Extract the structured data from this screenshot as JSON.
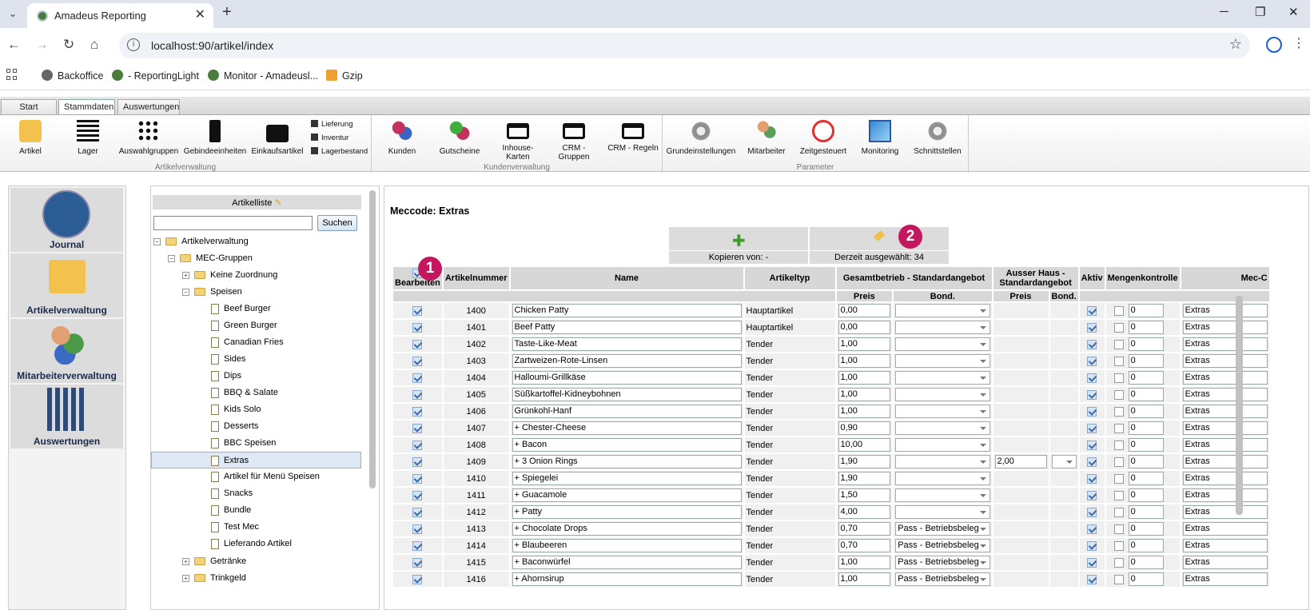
{
  "browser": {
    "tab_title": "Amadeus Reporting",
    "url": "localhost:90/artikel/index",
    "bookmarks": [
      "Backoffice",
      "- ReportingLight",
      "Monitor - Amadeusl...",
      "Gzip"
    ]
  },
  "ribbon": {
    "tabs": [
      "Start",
      "Stammdaten",
      "Auswertungen"
    ],
    "artikelverwaltung": {
      "label": "Artikelverwaltung",
      "buttons": [
        "Artikel",
        "Lager",
        "Auswahlgruppen",
        "Gebindeeinheiten",
        "Einkaufsartikel"
      ],
      "small": [
        "Lieferung",
        "Inventur",
        "Lagerbestand"
      ]
    },
    "kundenverwaltung": {
      "label": "Kundenverwaltung",
      "buttons": [
        "Kunden",
        "Gutscheine",
        "Inhouse-Karten",
        "CRM - Gruppen",
        "CRM - Regeln"
      ]
    },
    "parameter": {
      "label": "Parameter",
      "buttons": [
        "Grundeinstellungen",
        "Mitarbeiter",
        "Zeitgesteuert",
        "Monitoring",
        "Schnittstellen"
      ]
    }
  },
  "left_nav": [
    "Journal",
    "Artikelverwaltung",
    "Mitarbeiterverwaltung",
    "Auswertungen"
  ],
  "tree": {
    "header": "Artikelliste",
    "search_button": "Suchen",
    "root": "Artikelverwaltung",
    "group": "MEC-Gruppen",
    "keine_zuordnung": "Keine Zuordnung",
    "speisen": "Speisen",
    "speisen_children": [
      "Beef Burger",
      "Green Burger",
      "Canadian Fries",
      "Sides",
      "Dips",
      "BBQ & Salate",
      "Kids Solo",
      "Desserts",
      "BBC Speisen",
      "Extras",
      "Artikel für Menü Speisen",
      "Snacks",
      "Bundle",
      "Test Mec",
      "Lieferando Artikel"
    ],
    "selected": "Extras",
    "more_groups": [
      "Getränke",
      "Trinkgeld"
    ]
  },
  "content": {
    "title": "Meccode: Extras",
    "copy_label": "Kopieren von: -",
    "selected_label": "Derzeit ausgewählt: 34",
    "markers": [
      "1",
      "2"
    ],
    "headers": {
      "bearbeiten": "Bearbeiten",
      "artikelnummer": "Artikelnummer",
      "name": "Name",
      "artikeltyp": "Artikeltyp",
      "gesamtbetrieb": "Gesamtbetrieb - Standardangebot",
      "ausser_haus": "Ausser Haus - Standardangebot",
      "aktiv": "Aktiv",
      "mengenkontrolle": "Mengenkontrolle",
      "mec": "Mec-C",
      "preis": "Preis",
      "bond": "Bond."
    },
    "rows": [
      {
        "nr": "1400",
        "name": "Chicken Patty",
        "typ": "Hauptartikel",
        "preis": "0,00",
        "bond": "",
        "ah_preis": "",
        "menge": "0",
        "mec": "Extras"
      },
      {
        "nr": "1401",
        "name": "Beef Patty",
        "typ": "Hauptartikel",
        "preis": "0,00",
        "bond": "",
        "ah_preis": "",
        "menge": "0",
        "mec": "Extras"
      },
      {
        "nr": "1402",
        "name": "Taste-Like-Meat",
        "typ": "Tender",
        "preis": "1,00",
        "bond": "",
        "ah_preis": "",
        "menge": "0",
        "mec": "Extras"
      },
      {
        "nr": "1403",
        "name": "Zartweizen-Rote-Linsen",
        "typ": "Tender",
        "preis": "1,00",
        "bond": "",
        "ah_preis": "",
        "menge": "0",
        "mec": "Extras"
      },
      {
        "nr": "1404",
        "name": "Halloumi-Grillkäse",
        "typ": "Tender",
        "preis": "1,00",
        "bond": "",
        "ah_preis": "",
        "menge": "0",
        "mec": "Extras"
      },
      {
        "nr": "1405",
        "name": "Süßkartoffel-Kidneybohnen",
        "typ": "Tender",
        "preis": "1,00",
        "bond": "",
        "ah_preis": "",
        "menge": "0",
        "mec": "Extras"
      },
      {
        "nr": "1406",
        "name": "Grünkohl-Hanf",
        "typ": "Tender",
        "preis": "1,00",
        "bond": "",
        "ah_preis": "",
        "menge": "0",
        "mec": "Extras"
      },
      {
        "nr": "1407",
        "name": "+ Chester-Cheese",
        "typ": "Tender",
        "preis": "0,90",
        "bond": "",
        "ah_preis": "",
        "menge": "0",
        "mec": "Extras"
      },
      {
        "nr": "1408",
        "name": "+ Bacon",
        "typ": "Tender",
        "preis": "10,00",
        "bond": "",
        "ah_preis": "",
        "menge": "0",
        "mec": "Extras"
      },
      {
        "nr": "1409",
        "name": "+ 3 Onion Rings",
        "typ": "Tender",
        "preis": "1,90",
        "bond": "",
        "ah_preis": "2,00",
        "menge": "0",
        "mec": "Extras"
      },
      {
        "nr": "1410",
        "name": "+ Spiegelei",
        "typ": "Tender",
        "preis": "1,90",
        "bond": "",
        "ah_preis": "",
        "menge": "0",
        "mec": "Extras"
      },
      {
        "nr": "1411",
        "name": "+ Guacamole",
        "typ": "Tender",
        "preis": "1,50",
        "bond": "",
        "ah_preis": "",
        "menge": "0",
        "mec": "Extras"
      },
      {
        "nr": "1412",
        "name": "+ Patty",
        "typ": "Tender",
        "preis": "4,00",
        "bond": "",
        "ah_preis": "",
        "menge": "0",
        "mec": "Extras"
      },
      {
        "nr": "1413",
        "name": "+ Chocolate Drops",
        "typ": "Tender",
        "preis": "0,70",
        "bond": "Pass - Betriebsbeleg",
        "ah_preis": "",
        "menge": "0",
        "mec": "Extras"
      },
      {
        "nr": "1414",
        "name": "+ Blaubeeren",
        "typ": "Tender",
        "preis": "0,70",
        "bond": "Pass - Betriebsbeleg",
        "ah_preis": "",
        "menge": "0",
        "mec": "Extras"
      },
      {
        "nr": "1415",
        "name": "+ Baconwürfel",
        "typ": "Tender",
        "preis": "1,00",
        "bond": "Pass - Betriebsbeleg",
        "ah_preis": "",
        "menge": "0",
        "mec": "Extras"
      },
      {
        "nr": "1416",
        "name": "+ Ahornsirup",
        "typ": "Tender",
        "preis": "1,00",
        "bond": "Pass - Betriebsbeleg",
        "ah_preis": "",
        "menge": "0",
        "mec": "Extras"
      }
    ]
  }
}
